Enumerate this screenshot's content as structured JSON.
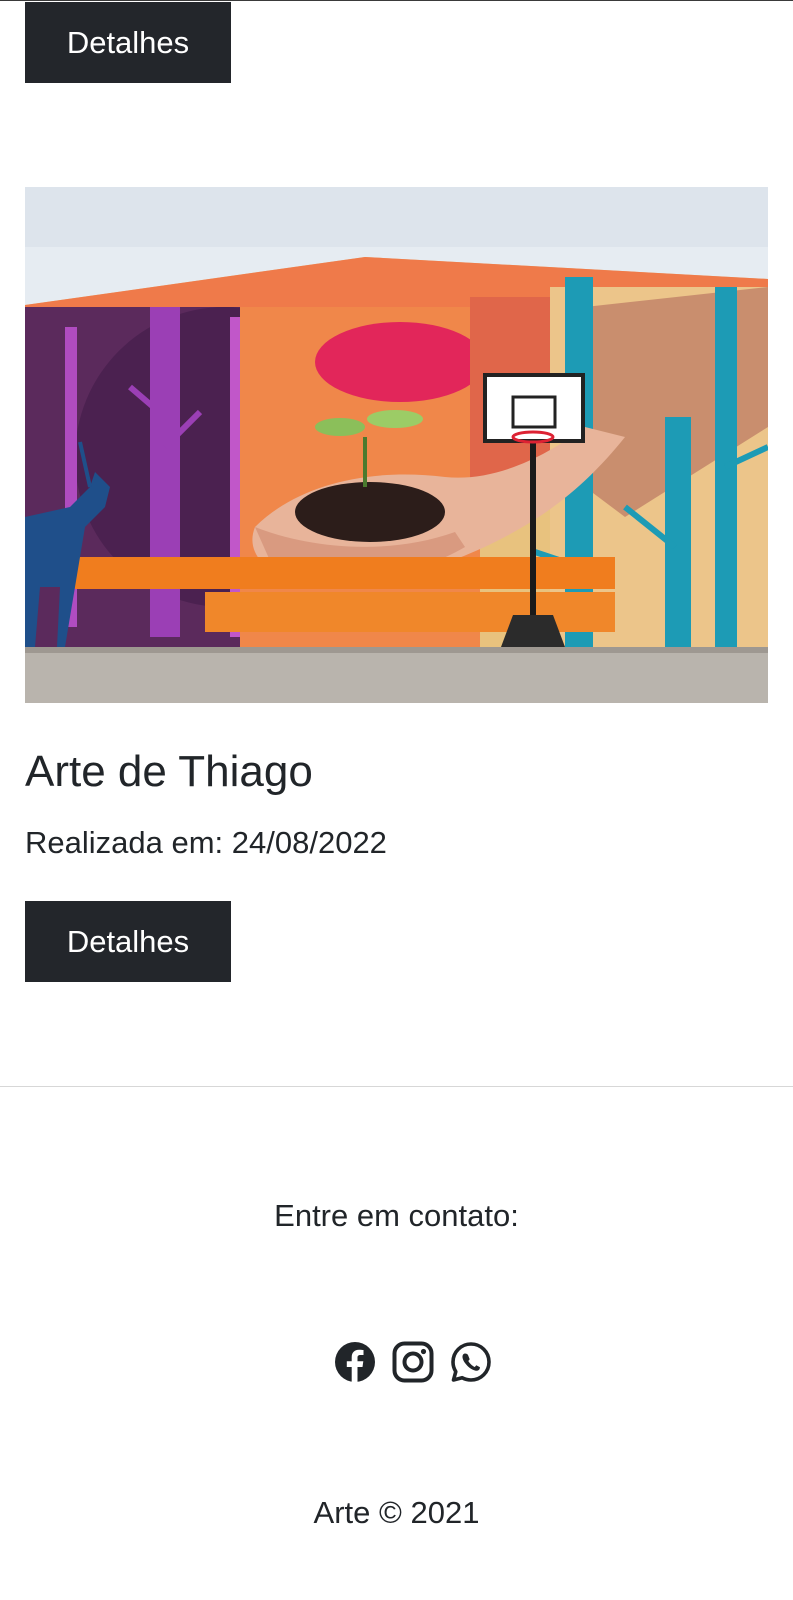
{
  "top_card": {
    "details_button": "Detalhes"
  },
  "card": {
    "image_alt": "Mural de arte urbana",
    "title": "Arte de Thiago",
    "date_text": "Realizada em: 24/08/2022",
    "details_button": "Detalhes"
  },
  "footer": {
    "contact_label": "Entre em contato:",
    "social": [
      {
        "name": "facebook-icon"
      },
      {
        "name": "instagram-icon"
      },
      {
        "name": "whatsapp-icon"
      }
    ],
    "copyright": "Arte © 2021"
  },
  "colors": {
    "button_bg": "#23262b",
    "text": "#212529",
    "divider": "#d7d7d7"
  }
}
